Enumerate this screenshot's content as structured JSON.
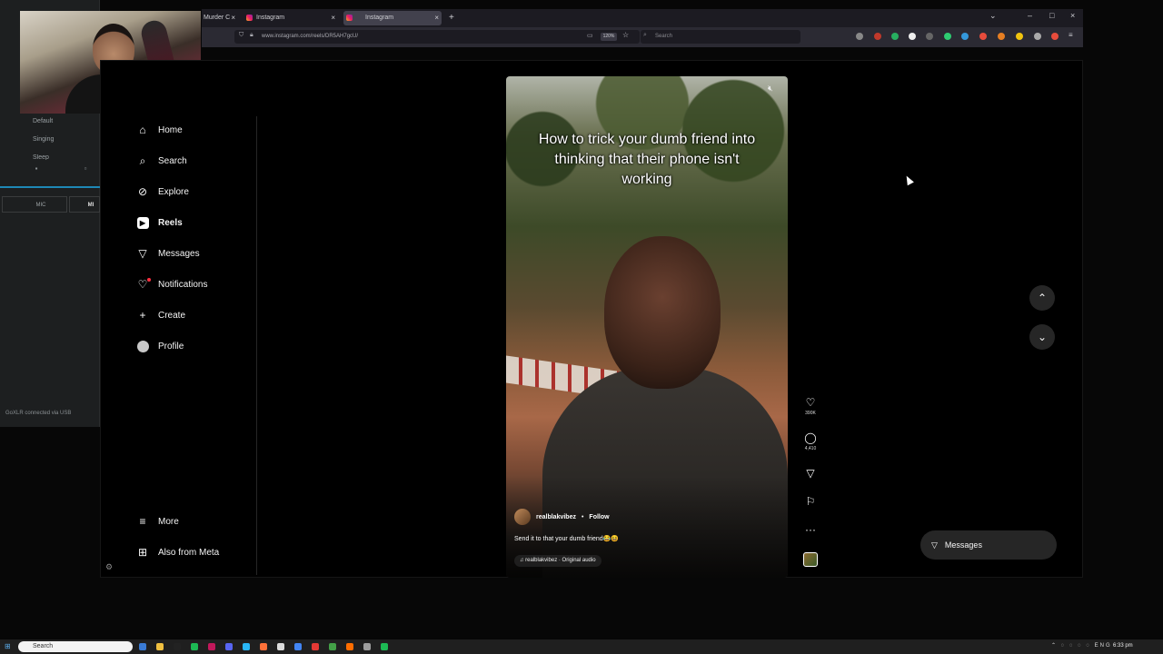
{
  "side_app": {
    "presets": [
      "Default",
      "Singing",
      "Sleep"
    ],
    "mic_label": "MIC",
    "mic_label_short": "MI",
    "status": "GoXLR connected via USB"
  },
  "browser": {
    "tabs": [
      {
        "title": "Murder C"
      },
      {
        "title": "Instagram"
      },
      {
        "title": "Instagram",
        "active": true
      }
    ],
    "url": "www.instagram.com/reels/DR5AH7gcU/",
    "zoom": "120%",
    "search_placeholder": "Search"
  },
  "sidebar": {
    "items": [
      {
        "label": "Home",
        "icon": "home-icon"
      },
      {
        "label": "Search",
        "icon": "search-icon"
      },
      {
        "label": "Explore",
        "icon": "compass-icon"
      },
      {
        "label": "Reels",
        "icon": "reels-icon",
        "active": true
      },
      {
        "label": "Messages",
        "icon": "send-icon"
      },
      {
        "label": "Notifications",
        "icon": "heart-icon"
      },
      {
        "label": "Create",
        "icon": "plus-icon"
      },
      {
        "label": "Profile",
        "icon": "avatar-icon"
      }
    ],
    "bottom": [
      {
        "label": "More",
        "icon": "menu-icon"
      },
      {
        "label": "Also from Meta",
        "icon": "grid-icon"
      }
    ]
  },
  "reel": {
    "caption": "How to trick your dumb friend into thinking that their phone isn't working",
    "author": "realblakvibez",
    "separator": "•",
    "follow": "Follow",
    "description": "Send it to that your dumb friend😂😆",
    "audio": "realblakvibez · Original audio",
    "likes": "390K",
    "comments": "4,410"
  },
  "messages_pill": "Messages",
  "taskbar": {
    "search": "Search",
    "tray": "ENG",
    "time": "6:33 pm"
  },
  "colors": {
    "accent": "#ff3040",
    "panel": "#262626"
  }
}
